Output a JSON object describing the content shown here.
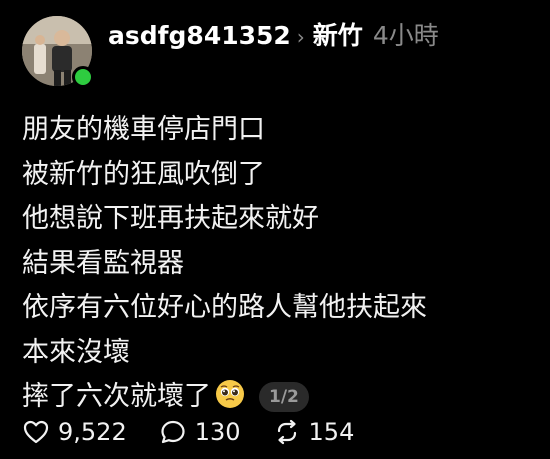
{
  "post": {
    "username": "asdfg841352",
    "location": "新竹",
    "time_ago": "4小時",
    "lines": [
      "朋友的機車停店門口",
      "被新竹的狂風吹倒了",
      "他想說下班再扶起來就好",
      "結果看監視器",
      "依序有六位好心的路人幫他扶起來",
      "本來沒壞",
      "摔了六次就壞了"
    ],
    "page_indicator": "1/2",
    "emoji_icon": "pleading-face-icon"
  },
  "actions": {
    "likes": "9,522",
    "comments": "130",
    "reposts": "154"
  },
  "colors": {
    "background": "#000000",
    "online": "#2ecc40",
    "muted": "#8a8a8a"
  }
}
